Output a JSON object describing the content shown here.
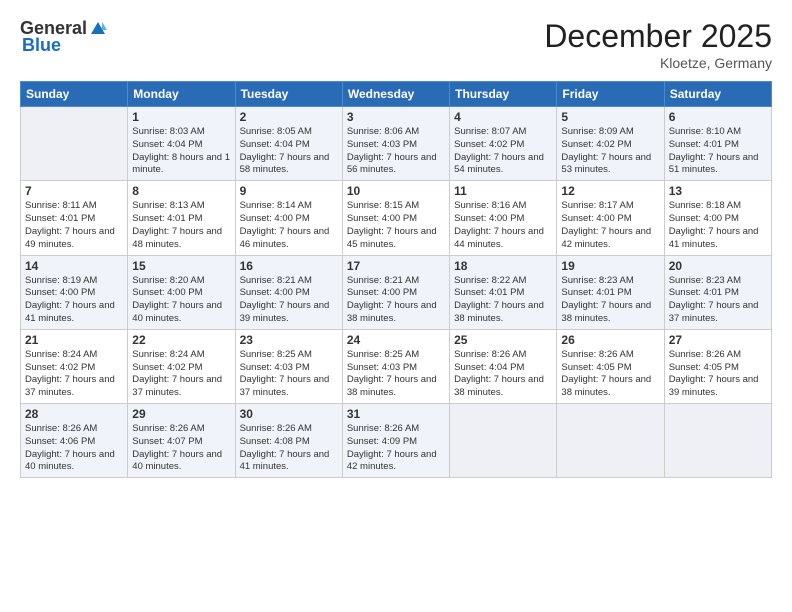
{
  "header": {
    "logo_line1": "General",
    "logo_line2": "Blue",
    "month_title": "December 2025",
    "location": "Kloetze, Germany"
  },
  "days_of_week": [
    "Sunday",
    "Monday",
    "Tuesday",
    "Wednesday",
    "Thursday",
    "Friday",
    "Saturday"
  ],
  "weeks": [
    [
      {
        "num": "",
        "sunrise": "",
        "sunset": "",
        "daylight": "",
        "empty": true
      },
      {
        "num": "1",
        "sunrise": "Sunrise: 8:03 AM",
        "sunset": "Sunset: 4:04 PM",
        "daylight": "Daylight: 8 hours and 1 minute."
      },
      {
        "num": "2",
        "sunrise": "Sunrise: 8:05 AM",
        "sunset": "Sunset: 4:04 PM",
        "daylight": "Daylight: 7 hours and 58 minutes."
      },
      {
        "num": "3",
        "sunrise": "Sunrise: 8:06 AM",
        "sunset": "Sunset: 4:03 PM",
        "daylight": "Daylight: 7 hours and 56 minutes."
      },
      {
        "num": "4",
        "sunrise": "Sunrise: 8:07 AM",
        "sunset": "Sunset: 4:02 PM",
        "daylight": "Daylight: 7 hours and 54 minutes."
      },
      {
        "num": "5",
        "sunrise": "Sunrise: 8:09 AM",
        "sunset": "Sunset: 4:02 PM",
        "daylight": "Daylight: 7 hours and 53 minutes."
      },
      {
        "num": "6",
        "sunrise": "Sunrise: 8:10 AM",
        "sunset": "Sunset: 4:01 PM",
        "daylight": "Daylight: 7 hours and 51 minutes."
      }
    ],
    [
      {
        "num": "7",
        "sunrise": "Sunrise: 8:11 AM",
        "sunset": "Sunset: 4:01 PM",
        "daylight": "Daylight: 7 hours and 49 minutes."
      },
      {
        "num": "8",
        "sunrise": "Sunrise: 8:13 AM",
        "sunset": "Sunset: 4:01 PM",
        "daylight": "Daylight: 7 hours and 48 minutes."
      },
      {
        "num": "9",
        "sunrise": "Sunrise: 8:14 AM",
        "sunset": "Sunset: 4:00 PM",
        "daylight": "Daylight: 7 hours and 46 minutes."
      },
      {
        "num": "10",
        "sunrise": "Sunrise: 8:15 AM",
        "sunset": "Sunset: 4:00 PM",
        "daylight": "Daylight: 7 hours and 45 minutes."
      },
      {
        "num": "11",
        "sunrise": "Sunrise: 8:16 AM",
        "sunset": "Sunset: 4:00 PM",
        "daylight": "Daylight: 7 hours and 44 minutes."
      },
      {
        "num": "12",
        "sunrise": "Sunrise: 8:17 AM",
        "sunset": "Sunset: 4:00 PM",
        "daylight": "Daylight: 7 hours and 42 minutes."
      },
      {
        "num": "13",
        "sunrise": "Sunrise: 8:18 AM",
        "sunset": "Sunset: 4:00 PM",
        "daylight": "Daylight: 7 hours and 41 minutes."
      }
    ],
    [
      {
        "num": "14",
        "sunrise": "Sunrise: 8:19 AM",
        "sunset": "Sunset: 4:00 PM",
        "daylight": "Daylight: 7 hours and 41 minutes."
      },
      {
        "num": "15",
        "sunrise": "Sunrise: 8:20 AM",
        "sunset": "Sunset: 4:00 PM",
        "daylight": "Daylight: 7 hours and 40 minutes."
      },
      {
        "num": "16",
        "sunrise": "Sunrise: 8:21 AM",
        "sunset": "Sunset: 4:00 PM",
        "daylight": "Daylight: 7 hours and 39 minutes."
      },
      {
        "num": "17",
        "sunrise": "Sunrise: 8:21 AM",
        "sunset": "Sunset: 4:00 PM",
        "daylight": "Daylight: 7 hours and 38 minutes."
      },
      {
        "num": "18",
        "sunrise": "Sunrise: 8:22 AM",
        "sunset": "Sunset: 4:01 PM",
        "daylight": "Daylight: 7 hours and 38 minutes."
      },
      {
        "num": "19",
        "sunrise": "Sunrise: 8:23 AM",
        "sunset": "Sunset: 4:01 PM",
        "daylight": "Daylight: 7 hours and 38 minutes."
      },
      {
        "num": "20",
        "sunrise": "Sunrise: 8:23 AM",
        "sunset": "Sunset: 4:01 PM",
        "daylight": "Daylight: 7 hours and 37 minutes."
      }
    ],
    [
      {
        "num": "21",
        "sunrise": "Sunrise: 8:24 AM",
        "sunset": "Sunset: 4:02 PM",
        "daylight": "Daylight: 7 hours and 37 minutes."
      },
      {
        "num": "22",
        "sunrise": "Sunrise: 8:24 AM",
        "sunset": "Sunset: 4:02 PM",
        "daylight": "Daylight: 7 hours and 37 minutes."
      },
      {
        "num": "23",
        "sunrise": "Sunrise: 8:25 AM",
        "sunset": "Sunset: 4:03 PM",
        "daylight": "Daylight: 7 hours and 37 minutes."
      },
      {
        "num": "24",
        "sunrise": "Sunrise: 8:25 AM",
        "sunset": "Sunset: 4:03 PM",
        "daylight": "Daylight: 7 hours and 38 minutes."
      },
      {
        "num": "25",
        "sunrise": "Sunrise: 8:26 AM",
        "sunset": "Sunset: 4:04 PM",
        "daylight": "Daylight: 7 hours and 38 minutes."
      },
      {
        "num": "26",
        "sunrise": "Sunrise: 8:26 AM",
        "sunset": "Sunset: 4:05 PM",
        "daylight": "Daylight: 7 hours and 38 minutes."
      },
      {
        "num": "27",
        "sunrise": "Sunrise: 8:26 AM",
        "sunset": "Sunset: 4:05 PM",
        "daylight": "Daylight: 7 hours and 39 minutes."
      }
    ],
    [
      {
        "num": "28",
        "sunrise": "Sunrise: 8:26 AM",
        "sunset": "Sunset: 4:06 PM",
        "daylight": "Daylight: 7 hours and 40 minutes."
      },
      {
        "num": "29",
        "sunrise": "Sunrise: 8:26 AM",
        "sunset": "Sunset: 4:07 PM",
        "daylight": "Daylight: 7 hours and 40 minutes."
      },
      {
        "num": "30",
        "sunrise": "Sunrise: 8:26 AM",
        "sunset": "Sunset: 4:08 PM",
        "daylight": "Daylight: 7 hours and 41 minutes."
      },
      {
        "num": "31",
        "sunrise": "Sunrise: 8:26 AM",
        "sunset": "Sunset: 4:09 PM",
        "daylight": "Daylight: 7 hours and 42 minutes."
      },
      {
        "num": "",
        "sunrise": "",
        "sunset": "",
        "daylight": "",
        "empty": true
      },
      {
        "num": "",
        "sunrise": "",
        "sunset": "",
        "daylight": "",
        "empty": true
      },
      {
        "num": "",
        "sunrise": "",
        "sunset": "",
        "daylight": "",
        "empty": true
      }
    ]
  ]
}
